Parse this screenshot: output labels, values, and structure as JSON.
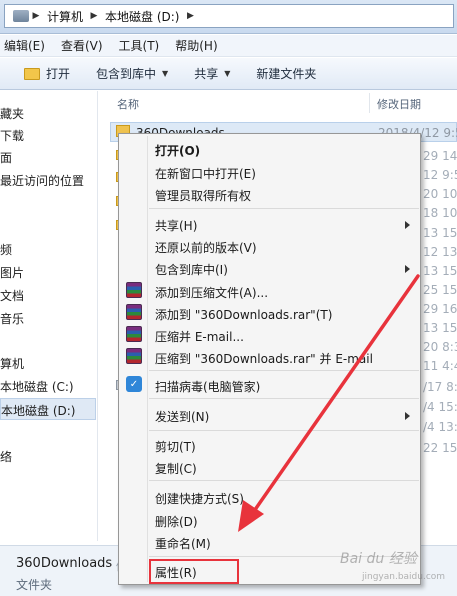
{
  "address": {
    "crumbs": [
      "计算机",
      "本地磁盘 (D:)"
    ]
  },
  "menubar": [
    "编辑(E)",
    "查看(V)",
    "工具(T)",
    "帮助(H)"
  ],
  "toolbar": {
    "open": "打开",
    "include_library": "包含到库中",
    "share": "共享",
    "new_folder": "新建文件夹"
  },
  "nav": {
    "items": [
      "藏夹",
      "下载",
      "面",
      "最近访问的位置",
      "频",
      "图片",
      "文档",
      "音乐",
      "算机",
      "本地磁盘 (C:)",
      "本地磁盘 (D:)",
      "络"
    ]
  },
  "columns": {
    "name": "名称",
    "date": "修改日期"
  },
  "selected_file": {
    "name": "360Downloads",
    "date": "2018/4/12 9:5"
  },
  "dates": [
    "29 14:5",
    "12 9:5",
    "20 10:5",
    "18 10:5",
    "13 15:1",
    "12 13:5",
    "13 15:1",
    "25 15:1",
    "29 16:3",
    "13 15:5",
    "20 8:3",
    "11 4:4",
    "/17 8:",
    "/4 15:",
    "/4 13:",
    "22 15:"
  ],
  "context_menu": {
    "items": [
      {
        "label": "打开(O)",
        "bold": true
      },
      {
        "label": "在新窗口中打开(E)"
      },
      {
        "label": "管理员取得所有权"
      },
      {
        "label": "共享(H)",
        "submenu": true
      },
      {
        "label": "还原以前的版本(V)"
      },
      {
        "label": "包含到库中(I)",
        "submenu": true
      },
      {
        "label": "添加到压缩文件(A)...",
        "icon": "winrar-icon"
      },
      {
        "label": "添加到 \"360Downloads.rar\"(T)",
        "icon": "winrar-icon"
      },
      {
        "label": "压缩并 E-mail...",
        "icon": "winrar-icon"
      },
      {
        "label": "压缩到 \"360Downloads.rar\" 并 E-mail",
        "icon": "winrar-icon"
      },
      {
        "label": "扫描病毒(电脑管家)",
        "icon": "shield-icon"
      },
      {
        "label": "发送到(N)",
        "submenu": true
      },
      {
        "label": "剪切(T)"
      },
      {
        "label": "复制(C)"
      },
      {
        "label": "创建快捷方式(S)"
      },
      {
        "label": "删除(D)"
      },
      {
        "label": "重命名(M)"
      },
      {
        "label": "属性(R)"
      }
    ]
  },
  "details": {
    "name": "360Downloads",
    "type": "文件夹",
    "extra": "修"
  },
  "annotation": {
    "color": "#e8333c"
  },
  "watermark": {
    "text": "Bai du 经验",
    "sub": "jingyan.baidu.com"
  }
}
